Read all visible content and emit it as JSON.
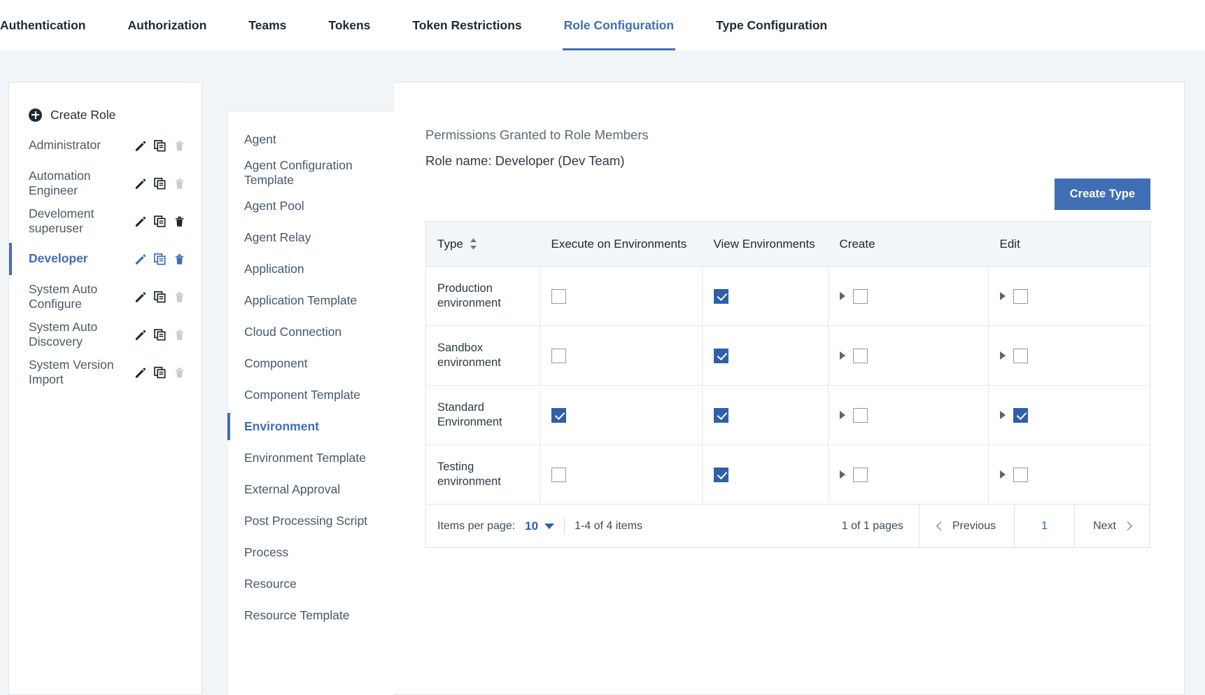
{
  "tabs": [
    {
      "label": "Authentication",
      "active": false
    },
    {
      "label": "Authorization",
      "active": false
    },
    {
      "label": "Teams",
      "active": false
    },
    {
      "label": "Tokens",
      "active": false
    },
    {
      "label": "Token Restrictions",
      "active": false
    },
    {
      "label": "Role Configuration",
      "active": true
    },
    {
      "label": "Type Configuration",
      "active": false
    }
  ],
  "colors": {
    "accent": "#3f6eb5",
    "checkbox_checked": "#2f5fa8",
    "button": "#3f6eb5",
    "page_background": "#f2f5f8"
  },
  "role_panel": {
    "create_label": "Create Role",
    "create_icon": "plus-circle-icon",
    "roles": [
      {
        "name": "Administrator",
        "selected": false,
        "delete_enabled": false
      },
      {
        "name": "Automation Engineer",
        "selected": false,
        "delete_enabled": false
      },
      {
        "name": "Develoment superuser",
        "selected": false,
        "delete_enabled": true
      },
      {
        "name": "Developer",
        "selected": true,
        "delete_enabled": true
      },
      {
        "name": "System Auto Configure",
        "selected": false,
        "delete_enabled": false
      },
      {
        "name": "System Auto Discovery",
        "selected": false,
        "delete_enabled": false
      },
      {
        "name": "System Version Import",
        "selected": false,
        "delete_enabled": false
      }
    ],
    "action_icons": [
      "edit-icon",
      "duplicate-icon",
      "delete-icon"
    ]
  },
  "type_panel": {
    "items": [
      {
        "label": "Agent",
        "selected": false
      },
      {
        "label": "Agent Configuration Template",
        "selected": false
      },
      {
        "label": "Agent Pool",
        "selected": false
      },
      {
        "label": "Agent Relay",
        "selected": false
      },
      {
        "label": "Application",
        "selected": false
      },
      {
        "label": "Application Template",
        "selected": false
      },
      {
        "label": "Cloud Connection",
        "selected": false
      },
      {
        "label": "Component",
        "selected": false
      },
      {
        "label": "Component Template",
        "selected": false
      },
      {
        "label": "Environment",
        "selected": true
      },
      {
        "label": "Environment Template",
        "selected": false
      },
      {
        "label": "External Approval",
        "selected": false
      },
      {
        "label": "Post Processing Script",
        "selected": false
      },
      {
        "label": "Process",
        "selected": false
      },
      {
        "label": "Resource",
        "selected": false
      },
      {
        "label": "Resource Template",
        "selected": false
      }
    ]
  },
  "main": {
    "permissions_title": "Permissions Granted to Role Members",
    "role_name_line": "Role name: Developer  (Dev Team)",
    "create_type_label": "Create Type",
    "table": {
      "columns": [
        {
          "label": "Type",
          "sortable": true
        },
        {
          "label": "Execute on Environments",
          "sortable": false
        },
        {
          "label": "View Environments",
          "sortable": false
        },
        {
          "label": "Create",
          "sortable": false
        },
        {
          "label": "Edit",
          "sortable": false
        }
      ],
      "rows": [
        {
          "type": "Production environment",
          "execute_on_environments": false,
          "view_environments": true,
          "create": {
            "expandable": true,
            "checked": false
          },
          "edit": {
            "expandable": true,
            "checked": false
          }
        },
        {
          "type": "Sandbox environment",
          "execute_on_environments": false,
          "view_environments": true,
          "create": {
            "expandable": true,
            "checked": false
          },
          "edit": {
            "expandable": true,
            "checked": false
          }
        },
        {
          "type": "Standard Environment",
          "execute_on_environments": true,
          "view_environments": true,
          "create": {
            "expandable": true,
            "checked": false
          },
          "edit": {
            "expandable": true,
            "checked": true
          }
        },
        {
          "type": "Testing environment",
          "execute_on_environments": false,
          "view_environments": true,
          "create": {
            "expandable": true,
            "checked": false
          },
          "edit": {
            "expandable": true,
            "checked": false
          }
        }
      ]
    },
    "pagination": {
      "items_per_page_label": "Items per page:",
      "items_per_page_value": "10",
      "range_text": "1-4 of 4 items",
      "pages_text": "1 of 1 pages",
      "previous_label": "Previous",
      "next_label": "Next",
      "current_page": "1"
    }
  }
}
